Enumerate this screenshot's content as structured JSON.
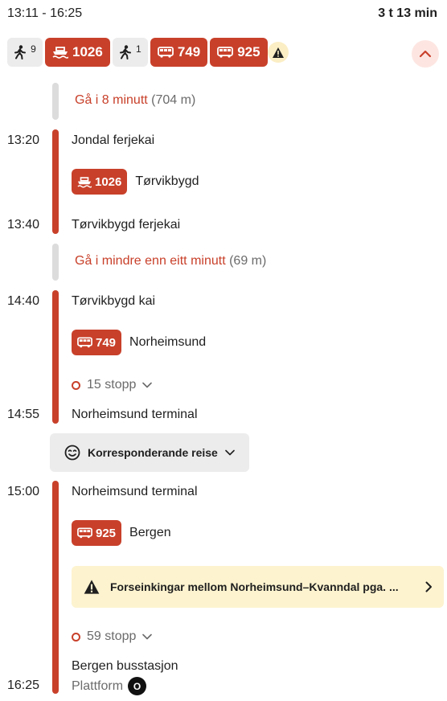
{
  "header": {
    "time_range": "13:11 - 16:25",
    "duration": "3 t 13 min"
  },
  "summary": {
    "walk1_minutes": "9",
    "leg1_number": "1026",
    "walk2_minutes": "1",
    "leg2_number": "749",
    "leg3_number": "925"
  },
  "legs": {
    "walk1": {
      "label": "Gå i 8 minutt",
      "distance": "(704 m)"
    },
    "ferry": {
      "dep_time": "13:20",
      "dep_stop": "Jondal ferjekai",
      "line": "1026",
      "destination": "Tørvikbygd",
      "arr_time": "13:40",
      "arr_stop": "Tørvikbygd ferjekai"
    },
    "walk2": {
      "label": "Gå i mindre enn eitt minutt",
      "distance": "(69 m)"
    },
    "bus1": {
      "dep_time": "14:40",
      "dep_stop": "Tørvikbygd kai",
      "line": "749",
      "destination": "Norheimsund",
      "stops": "15 stopp",
      "arr_time": "14:55",
      "arr_stop": "Norheimsund terminal"
    },
    "connection": {
      "label": "Korresponderande reise"
    },
    "bus2": {
      "dep_time": "15:00",
      "dep_stop": "Norheimsund terminal",
      "line": "925",
      "destination": "Bergen",
      "alert": "Forseinkingar mellom Norheimsund–Kvanndal pga. ...",
      "stops": "59 stopp",
      "arr_time": "16:25",
      "arr_stop": "Bergen busstasjon",
      "platform_label": "Plattform",
      "platform_code": "O"
    }
  },
  "colors": {
    "accent": "#c8402a",
    "walk_bar": "#dcdcdc",
    "chip_bg": "#ececec",
    "alert_bg": "#fdf3cf",
    "muted_text": "#6b6b6b"
  },
  "icons": [
    "walk-icon",
    "ferry-icon",
    "bus-icon",
    "warning-icon",
    "chevron-up-icon",
    "chevron-down-icon",
    "smiley-icon",
    "chevron-right-icon"
  ]
}
